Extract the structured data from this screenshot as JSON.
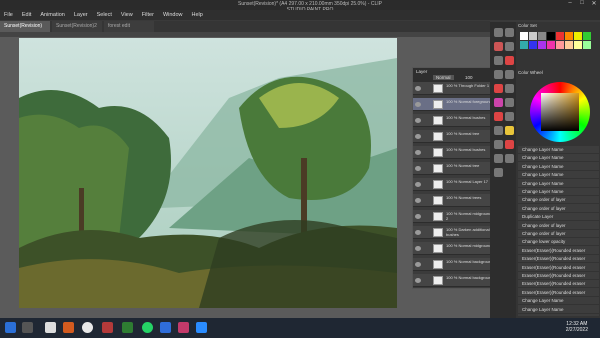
{
  "window": {
    "title": "Sunset(Revision)* (A4 297.00 x 210.00mm 350dpi 25.0%) - CLIP STUDIO PAINT PRO"
  },
  "menu": [
    "File",
    "Edit",
    "Animation",
    "Layer",
    "Select",
    "View",
    "Filter",
    "Window",
    "Help"
  ],
  "tabs": [
    "Sunset(Revision)",
    "Sunset(Revision)2",
    "forest edit"
  ],
  "layers_panel": {
    "header": "Layer",
    "blend_mode": "Normal",
    "opacity": "100"
  },
  "layers": [
    {
      "name": "100 % Through Folder 1",
      "sel": false
    },
    {
      "name": "100 % Normal foreground",
      "sel": true
    },
    {
      "name": "100 % Normal bushes",
      "sel": false
    },
    {
      "name": "100 % Normal tree",
      "sel": false
    },
    {
      "name": "100 % Normal bushes",
      "sel": false
    },
    {
      "name": "100 % Normal tree",
      "sel": false
    },
    {
      "name": "100 % Normal Layer 17",
      "sel": false
    },
    {
      "name": "100 % Normal trees",
      "sel": false
    },
    {
      "name": "100 % Normal midground 2",
      "sel": false
    },
    {
      "name": "100 % Darken additional bushes",
      "sel": false
    },
    {
      "name": "100 % Normal midground",
      "sel": false
    },
    {
      "name": "100 % Normal background",
      "sel": false
    },
    {
      "name": "100 % Normal background",
      "sel": false
    }
  ],
  "right_panel": {
    "color_set_title": "Color Set",
    "color_wheel_title": "Color Wheel"
  },
  "history": [
    "Change Layer Name",
    "Change Layer Name",
    "Change Layer Name",
    "Change Layer Name",
    "Change Layer Name",
    "Change Layer Name",
    "Change order of layer",
    "Change order of layer",
    "Duplicate Layer",
    "Change order of layer",
    "Change order of layer",
    "Change lower opacity",
    "Eraser(Eraser)(Rounded eraser",
    "Eraser(Eraser)(Rounded eraser",
    "Eraser(Eraser)(Rounded eraser",
    "Eraser(Eraser)(Rounded eraser",
    "Eraser(Eraser)(Rounded eraser",
    "Eraser(Eraser)(Rounded eraser",
    "Change Layer Name",
    "Change Layer Name"
  ],
  "taskbar": {
    "time": "12:32 AM",
    "date": "2/27/2022"
  }
}
